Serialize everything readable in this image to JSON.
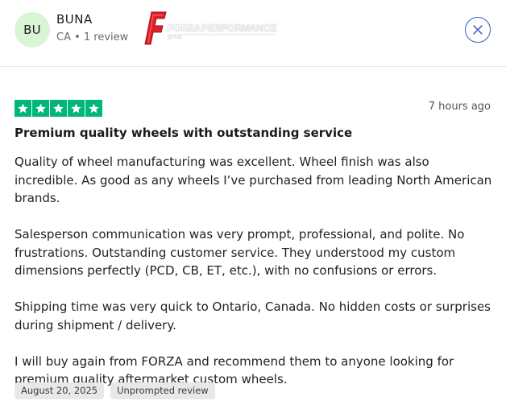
{
  "reviewer": {
    "initials": "BU",
    "name": "BUNA",
    "meta": "CA • 1 review"
  },
  "logo": {
    "brand": "FORZA",
    "sub": "PERFORMANCE",
    "tagline": "group"
  },
  "icons": {
    "close": "close-icon",
    "star": "star-icon"
  },
  "review": {
    "rating": 5,
    "time_ago": "7 hours ago",
    "title": "Premium quality wheels with outstanding service",
    "paragraphs": [
      "Quality of wheel manufacturing was excellent. Wheel finish was also incredible. As good as any wheels I’ve purchased from leading North American brands.",
      "Salesperson communication was very prompt, professional, and polite. No frustrations. Outstanding customer service. They understood my custom dimensions perfectly (PCD, CB, ET, etc.), with no confusions or errors.",
      "Shipping time was very quick to Ontario, Canada. No hidden costs or surprises during shipment / delivery.",
      "I will buy again from FORZA and recommend them to anyone looking for premium quality aftermarket custom wheels."
    ],
    "date": "August 20, 2025",
    "badge": "Unprompted review"
  },
  "colors": {
    "star_green": "#00b67a",
    "avatar_bg": "#d9f5d6",
    "close_blue": "#3c57c8",
    "logo_red": "#e0202a"
  }
}
